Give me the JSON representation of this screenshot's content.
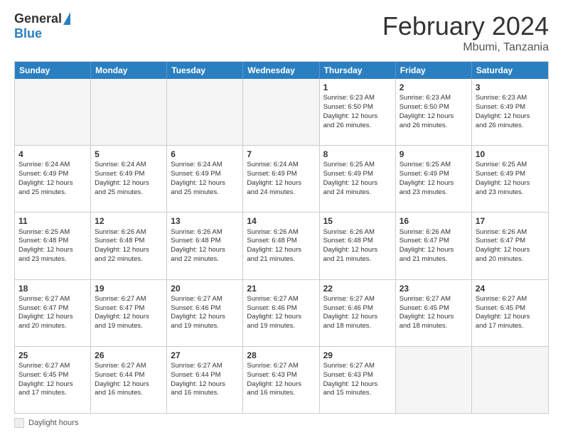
{
  "logo": {
    "general": "General",
    "blue": "Blue"
  },
  "title": "February 2024",
  "subtitle": "Mbumi, Tanzania",
  "weekdays": [
    "Sunday",
    "Monday",
    "Tuesday",
    "Wednesday",
    "Thursday",
    "Friday",
    "Saturday"
  ],
  "footer": {
    "label": "Daylight hours"
  },
  "weeks": [
    [
      {
        "day": "",
        "info": "",
        "empty": true
      },
      {
        "day": "",
        "info": "",
        "empty": true
      },
      {
        "day": "",
        "info": "",
        "empty": true
      },
      {
        "day": "",
        "info": "",
        "empty": true
      },
      {
        "day": "1",
        "info": "Sunrise: 6:23 AM\nSunset: 6:50 PM\nDaylight: 12 hours\nand 26 minutes.",
        "empty": false
      },
      {
        "day": "2",
        "info": "Sunrise: 6:23 AM\nSunset: 6:50 PM\nDaylight: 12 hours\nand 26 minutes.",
        "empty": false
      },
      {
        "day": "3",
        "info": "Sunrise: 6:23 AM\nSunset: 6:49 PM\nDaylight: 12 hours\nand 26 minutes.",
        "empty": false
      }
    ],
    [
      {
        "day": "4",
        "info": "Sunrise: 6:24 AM\nSunset: 6:49 PM\nDaylight: 12 hours\nand 25 minutes.",
        "empty": false
      },
      {
        "day": "5",
        "info": "Sunrise: 6:24 AM\nSunset: 6:49 PM\nDaylight: 12 hours\nand 25 minutes.",
        "empty": false
      },
      {
        "day": "6",
        "info": "Sunrise: 6:24 AM\nSunset: 6:49 PM\nDaylight: 12 hours\nand 25 minutes.",
        "empty": false
      },
      {
        "day": "7",
        "info": "Sunrise: 6:24 AM\nSunset: 6:49 PM\nDaylight: 12 hours\nand 24 minutes.",
        "empty": false
      },
      {
        "day": "8",
        "info": "Sunrise: 6:25 AM\nSunset: 6:49 PM\nDaylight: 12 hours\nand 24 minutes.",
        "empty": false
      },
      {
        "day": "9",
        "info": "Sunrise: 6:25 AM\nSunset: 6:49 PM\nDaylight: 12 hours\nand 23 minutes.",
        "empty": false
      },
      {
        "day": "10",
        "info": "Sunrise: 6:25 AM\nSunset: 6:49 PM\nDaylight: 12 hours\nand 23 minutes.",
        "empty": false
      }
    ],
    [
      {
        "day": "11",
        "info": "Sunrise: 6:25 AM\nSunset: 6:48 PM\nDaylight: 12 hours\nand 23 minutes.",
        "empty": false
      },
      {
        "day": "12",
        "info": "Sunrise: 6:26 AM\nSunset: 6:48 PM\nDaylight: 12 hours\nand 22 minutes.",
        "empty": false
      },
      {
        "day": "13",
        "info": "Sunrise: 6:26 AM\nSunset: 6:48 PM\nDaylight: 12 hours\nand 22 minutes.",
        "empty": false
      },
      {
        "day": "14",
        "info": "Sunrise: 6:26 AM\nSunset: 6:48 PM\nDaylight: 12 hours\nand 21 minutes.",
        "empty": false
      },
      {
        "day": "15",
        "info": "Sunrise: 6:26 AM\nSunset: 6:48 PM\nDaylight: 12 hours\nand 21 minutes.",
        "empty": false
      },
      {
        "day": "16",
        "info": "Sunrise: 6:26 AM\nSunset: 6:47 PM\nDaylight: 12 hours\nand 21 minutes.",
        "empty": false
      },
      {
        "day": "17",
        "info": "Sunrise: 6:26 AM\nSunset: 6:47 PM\nDaylight: 12 hours\nand 20 minutes.",
        "empty": false
      }
    ],
    [
      {
        "day": "18",
        "info": "Sunrise: 6:27 AM\nSunset: 6:47 PM\nDaylight: 12 hours\nand 20 minutes.",
        "empty": false
      },
      {
        "day": "19",
        "info": "Sunrise: 6:27 AM\nSunset: 6:47 PM\nDaylight: 12 hours\nand 19 minutes.",
        "empty": false
      },
      {
        "day": "20",
        "info": "Sunrise: 6:27 AM\nSunset: 6:46 PM\nDaylight: 12 hours\nand 19 minutes.",
        "empty": false
      },
      {
        "day": "21",
        "info": "Sunrise: 6:27 AM\nSunset: 6:46 PM\nDaylight: 12 hours\nand 19 minutes.",
        "empty": false
      },
      {
        "day": "22",
        "info": "Sunrise: 6:27 AM\nSunset: 6:46 PM\nDaylight: 12 hours\nand 18 minutes.",
        "empty": false
      },
      {
        "day": "23",
        "info": "Sunrise: 6:27 AM\nSunset: 6:45 PM\nDaylight: 12 hours\nand 18 minutes.",
        "empty": false
      },
      {
        "day": "24",
        "info": "Sunrise: 6:27 AM\nSunset: 6:45 PM\nDaylight: 12 hours\nand 17 minutes.",
        "empty": false
      }
    ],
    [
      {
        "day": "25",
        "info": "Sunrise: 6:27 AM\nSunset: 6:45 PM\nDaylight: 12 hours\nand 17 minutes.",
        "empty": false
      },
      {
        "day": "26",
        "info": "Sunrise: 6:27 AM\nSunset: 6:44 PM\nDaylight: 12 hours\nand 16 minutes.",
        "empty": false
      },
      {
        "day": "27",
        "info": "Sunrise: 6:27 AM\nSunset: 6:44 PM\nDaylight: 12 hours\nand 16 minutes.",
        "empty": false
      },
      {
        "day": "28",
        "info": "Sunrise: 6:27 AM\nSunset: 6:43 PM\nDaylight: 12 hours\nand 16 minutes.",
        "empty": false
      },
      {
        "day": "29",
        "info": "Sunrise: 6:27 AM\nSunset: 6:43 PM\nDaylight: 12 hours\nand 15 minutes.",
        "empty": false
      },
      {
        "day": "",
        "info": "",
        "empty": true
      },
      {
        "day": "",
        "info": "",
        "empty": true
      }
    ]
  ]
}
